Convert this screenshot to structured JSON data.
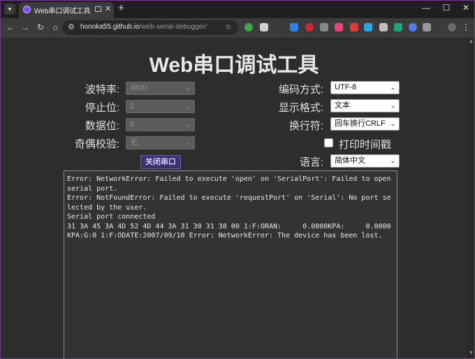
{
  "browser": {
    "tab_title": "Web串口调试工具",
    "url_host": "honoka55.github.io",
    "url_path": "/web-serial-debugger/"
  },
  "page": {
    "title": "Web串口调试工具",
    "baud_rate": {
      "label": "波特率:",
      "value": "4800"
    },
    "stop_bits": {
      "label": "停止位:",
      "value": "2"
    },
    "data_bits": {
      "label": "数据位:",
      "value": "8"
    },
    "parity": {
      "label": "奇偶校验:",
      "value": "无"
    },
    "encoding": {
      "label": "编码方式:",
      "value": "UTF-8"
    },
    "display_format": {
      "label": "显示格式:",
      "value": "文本"
    },
    "line_ending": {
      "label": "换行符:",
      "value": "回车换行CRLF"
    },
    "print_timestamp": {
      "label": "打印时间戳",
      "checked": false
    },
    "language": {
      "label": "语言:",
      "value": "简体中文"
    },
    "close_port_label": "关闭串口",
    "console_lines": [
      "Error: NetworkError: Failed to execute 'open' on 'SerialPort': Failed to open serial port.",
      "Error: NotFoundError: Failed to execute 'requestPort' on 'Serial': No port selected by the user.",
      "Serial port connected",
      "31 3A 45 3A 4D 52 4D 44 3A 31 30 31 38 00 1:F:ORAN:     0.0000KPA:     0.0000KPA:G:0 1:F:ODATE:2007/09/10 Error: NetworkError: The device has been lost."
    ]
  }
}
